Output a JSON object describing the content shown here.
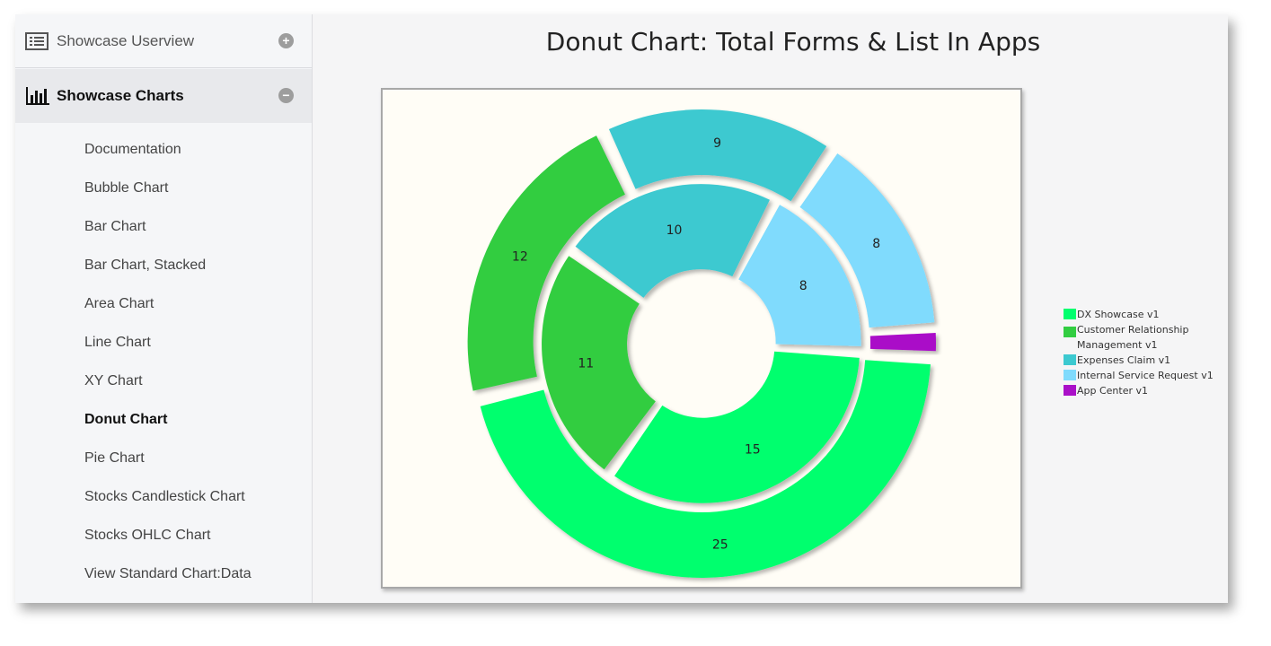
{
  "sidebar": {
    "groups": [
      {
        "label": "Showcase Userview",
        "toggle": "+"
      },
      {
        "label": "Showcase Charts",
        "toggle": "−"
      }
    ],
    "items": [
      {
        "label": "Documentation"
      },
      {
        "label": "Bubble Chart"
      },
      {
        "label": "Bar Chart"
      },
      {
        "label": "Bar Chart, Stacked"
      },
      {
        "label": "Area Chart"
      },
      {
        "label": "Line Chart"
      },
      {
        "label": "XY Chart"
      },
      {
        "label": "Donut Chart",
        "active": true
      },
      {
        "label": "Pie Chart"
      },
      {
        "label": "Stocks Candlestick Chart"
      },
      {
        "label": "Stocks OHLC Chart"
      },
      {
        "label": "View Standard Chart:Data"
      }
    ]
  },
  "chart_data": {
    "type": "donut",
    "title": "Donut Chart: Total Forms & List In Apps",
    "categories": [
      "DX Showcase v1",
      "Customer Relationship Management v1",
      "Expenses Claim v1",
      "Internal Service Request v1",
      "App Center v1"
    ],
    "colors": [
      "#00ff6e",
      "#32cd41",
      "#3cc9d0",
      "#80dbfd",
      "#aa10c8"
    ],
    "series": [
      {
        "ring": "inner",
        "values": [
          15,
          11,
          10,
          8,
          0
        ]
      },
      {
        "ring": "outer",
        "values": [
          25,
          12,
          9,
          8,
          1
        ]
      }
    ],
    "legend": "right"
  }
}
